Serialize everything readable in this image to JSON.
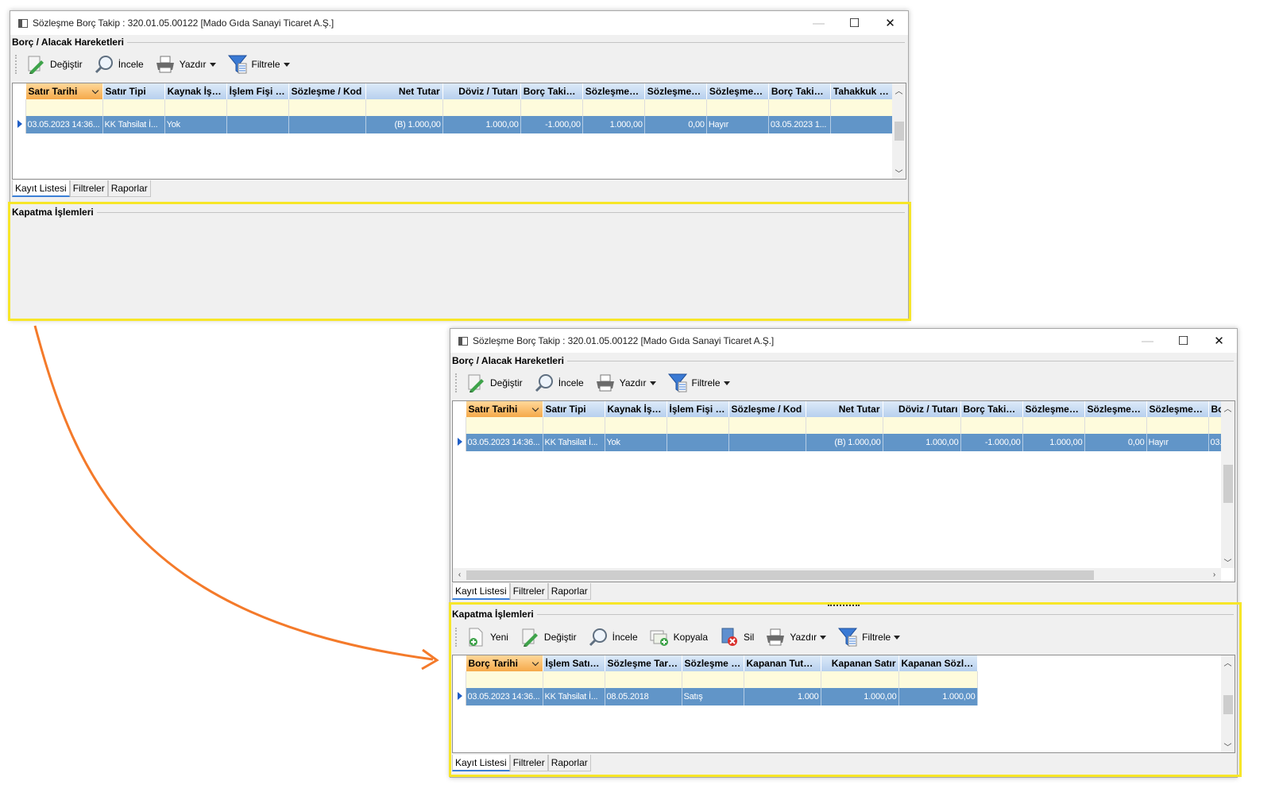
{
  "window": {
    "title": "Sözleşme Borç Takip : 320.01.05.00122 [Mado Gıda Sanayi Ticaret A.Ş.]",
    "minimize_glyph": "—",
    "maximize_glyph": "☐",
    "close_glyph": "✕"
  },
  "top_section": {
    "title": "Borç / Alacak Hareketleri",
    "toolbar": [
      {
        "label": "Değiştir",
        "icon": "edit-icon"
      },
      {
        "label": "İncele",
        "icon": "magnifier-icon"
      },
      {
        "label": "Yazdır",
        "icon": "printer-icon",
        "dropdown": true
      },
      {
        "label": "Filtrele",
        "icon": "filter-funnel-icon",
        "dropdown": true
      }
    ],
    "columns": [
      "Satır Tarihi",
      "Satır Tipi",
      "Kaynak İşlem",
      "İşlem Fişi / ...",
      "Sözleşme / Kod",
      "Net Tutar",
      "Döviz / Tutarı",
      "Borç Takip ...",
      "Sözleşmey...",
      "Sözleşmey...",
      "Sözleşmey...",
      "Borç Takip ...",
      "Tahakkuk S...",
      "Bo"
    ],
    "row": [
      "03.05.2023 14:36...",
      "KK Tahsilat İ...",
      "Yok",
      "",
      "",
      "(B) 1.000,00",
      "1.000,00",
      "-1.000,00",
      "1.000,00",
      "0,00",
      "Hayır",
      "03.05.2023 1...",
      "",
      "03."
    ]
  },
  "tabs": [
    "Kayıt Listesi",
    "Filtreler",
    "Raporlar"
  ],
  "bottom_section": {
    "title": "Kapatma İşlemleri",
    "toolbar": [
      {
        "label": "Yeni",
        "icon": "new-document-icon"
      },
      {
        "label": "Değiştir",
        "icon": "edit-icon"
      },
      {
        "label": "İncele",
        "icon": "magnifier-icon"
      },
      {
        "label": "Kopyala",
        "icon": "copy-icon"
      },
      {
        "label": "Sil",
        "icon": "delete-icon"
      },
      {
        "label": "Yazdır",
        "icon": "printer-icon",
        "dropdown": true
      },
      {
        "label": "Filtrele",
        "icon": "filter-funnel-icon",
        "dropdown": true
      }
    ],
    "columns": [
      "Borç Tarihi",
      "İşlem Satırı ...",
      "Sözleşme Tarihi",
      "Sözleşme / ...",
      "Kapanan Tutar ...",
      "Kapanan Satır",
      "Kapanan Sözleş..."
    ],
    "row": [
      "03.05.2023 14:36...",
      "KK Tahsilat İ...",
      "08.05.2018",
      "Satış",
      "1.000",
      "1.000,00",
      "1.000,00"
    ]
  },
  "colors": {
    "highlight": "#f7e628",
    "arrow": "#f47a2a",
    "selected_row": "#6195c8",
    "filter_row": "#fefbdc"
  }
}
